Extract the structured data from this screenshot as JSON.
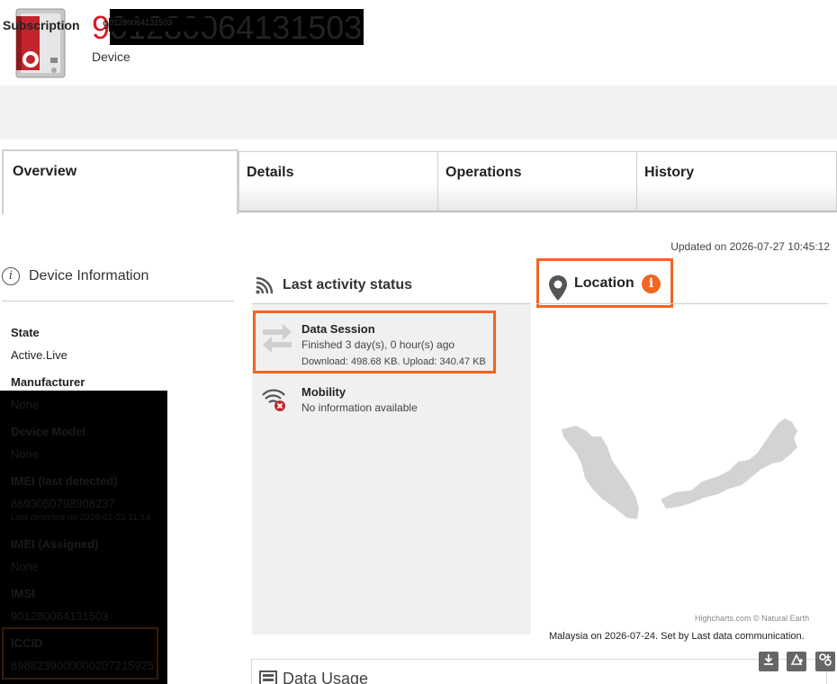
{
  "header": {
    "device_id_prefix": "9",
    "device_id_redacted": "01280064131503",
    "device_type": "Device"
  },
  "subscription": {
    "label": "Subscription",
    "value_prefix": "9",
    "value_redacted": "01280064131503"
  },
  "tabs": [
    {
      "label": "Overview",
      "active": true
    },
    {
      "label": "Details",
      "active": false
    },
    {
      "label": "Operations",
      "active": false
    },
    {
      "label": "History",
      "active": false
    }
  ],
  "updated": "Updated on 2026-07-27 10:45:12",
  "device_info": {
    "title": "Device Information",
    "state_label": "State",
    "state_value": "Active.Live",
    "manufacturer_label": "Manufacturer",
    "redacted_fields": {
      "manufacturer_value": "None",
      "model_label": "Device Model",
      "model_value": "None",
      "imei_last_label": "IMEI (last detected)",
      "imei_last_value": "8693050798908237",
      "imei_last_sub": "Last detected on 2026-01-22 11:14",
      "imei_assigned_label": "IMEI (Assigned)",
      "imei_assigned_value": "None",
      "imsi_label": "IMSI",
      "imsi_value": "901280064131503",
      "iccid_label": "ICCID",
      "iccid_value": "8988239000000207215925"
    }
  },
  "activity": {
    "title": "Last activity status",
    "data_session": {
      "title": "Data Session",
      "subtitle": "Finished 3 day(s), 0 hour(s) ago",
      "detail": "Download: 498.68 KB. Upload: 340.47 KB"
    },
    "mobility": {
      "title": "Mobility",
      "subtitle": "No information available"
    }
  },
  "location": {
    "title": "Location",
    "info_glyph": "i",
    "credit": "Highcharts.com © Natural Earth",
    "caption": "Malaysia on 2026-07-24. Set by Last data communication."
  },
  "data_usage": {
    "title": "Data Usage"
  },
  "colors": {
    "brand_red": "#d71920",
    "highlight_orange": "#f26522",
    "map_land": "#d3d3d3"
  },
  "icons": [
    "vodafone-device-icon",
    "info-icon",
    "wifi-signal-icon",
    "transfer-arrows-icon",
    "mobility-error-icon",
    "map-pin-icon",
    "download-icon",
    "chart-settings-icon",
    "fullscreen-icon"
  ]
}
